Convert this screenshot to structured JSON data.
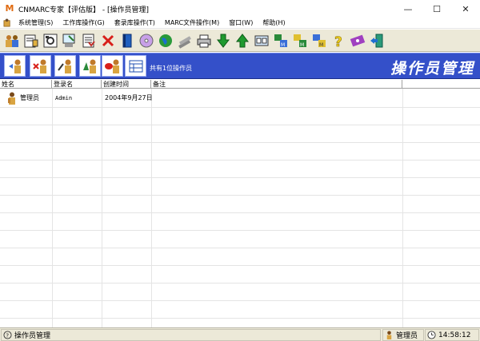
{
  "window": {
    "title": "CNMARC专家【评估版】 - [操作员管理]",
    "logo_letter": "M",
    "controls": [
      "—",
      "☐",
      "✕"
    ]
  },
  "menubar": {
    "items": [
      {
        "label": "系统管理(S)"
      },
      {
        "label": "工作库操作(G)"
      },
      {
        "label": "套录库操作(T)"
      },
      {
        "label": "MARC文件操作(M)"
      },
      {
        "label": "窗口(W)"
      },
      {
        "label": "帮助(H)"
      }
    ]
  },
  "toolbar": {
    "buttons": [
      "operators-icon",
      "catalog-card-icon",
      "settings-card-icon",
      "record-edit-icon",
      "print-list-icon",
      "delete-icon",
      "book-icon",
      "disc-icon",
      "globe-icon",
      "book-stack-icon",
      "printer-icon",
      "download-arrow-icon",
      "upload-arrow-icon",
      "dual-window-icon",
      "marc-export-icon",
      "marc-import-icon",
      "marc-convert-icon",
      "help-icon",
      "about-icon",
      "exit-icon"
    ]
  },
  "panel": {
    "buttons": [
      "add-operator-icon",
      "delete-operator-icon",
      "edit-operator-icon",
      "operator-rights-icon",
      "stop-operator-icon",
      "operator-list-icon"
    ],
    "count_text": "共有1位操作员",
    "heading": "操作员管理",
    "accent_color": "#3450c9"
  },
  "grid": {
    "columns": [
      "姓名",
      "登录名",
      "创建时间",
      "备注"
    ],
    "rows": [
      {
        "name": "管理员",
        "login": "Admin",
        "created": "2004年9月27日",
        "note": ""
      }
    ]
  },
  "statusbar": {
    "left_text": "操作员管理",
    "user_text": "管理员",
    "time_text": "14:58:12"
  }
}
